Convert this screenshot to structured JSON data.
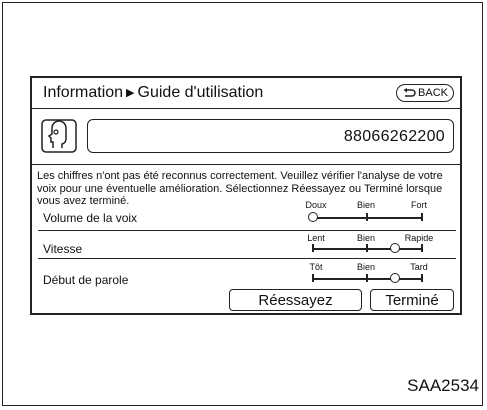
{
  "header": {
    "title_prefix": "Information",
    "title_arrow": "▶",
    "title_page": "Guide d'utilisation",
    "back_label": "BACK"
  },
  "result": {
    "number": "88066262200"
  },
  "message": "Les chiffres n'ont pas été reconnus correctement. Veuillez vérifier l'analyse de votre voix pour une éventuelle amélioration. Sélectionnez Réessayez ou Terminé lorsque vous avez terminé.",
  "rows": [
    {
      "label": "Volume de la voix",
      "scale": [
        "Doux",
        "Bien",
        "Fort"
      ],
      "level": 0.0
    },
    {
      "label": "Vitesse",
      "scale": [
        "Lent",
        "Bien",
        "Rapide"
      ],
      "level": 0.75
    },
    {
      "label": "Début de parole",
      "scale": [
        "Tôt",
        "Bien",
        "Tard"
      ],
      "level": 0.75
    }
  ],
  "buttons": {
    "retry": "Réessayez",
    "done": "Terminé"
  },
  "figure_code": "SAA2534",
  "icons": {
    "voice": "speaking-head-icon",
    "back": "back-arrow-icon"
  }
}
